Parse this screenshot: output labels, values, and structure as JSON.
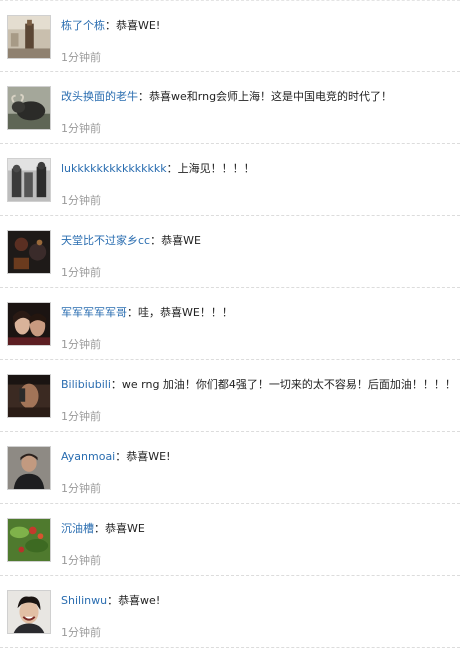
{
  "comments": [
    {
      "user": "栋了个栋",
      "sep": "：",
      "text": "恭喜WE!",
      "time": "1分钟前",
      "avatar": "avatar-street-photo"
    },
    {
      "user": "改头换面的老牛",
      "sep": "：",
      "text": "恭喜we和rng会师上海！这是中国电竞的时代了！",
      "time": "1分钟前",
      "avatar": "avatar-ox-photo"
    },
    {
      "user": "lukkkkkkkkkkkkkkk",
      "sep": "：",
      "text": "上海见！！！！",
      "time": "1分钟前",
      "avatar": "avatar-bw-photo"
    },
    {
      "user": "天堂比不过家乡cc",
      "sep": "：",
      "text": "恭喜WE",
      "time": "1分钟前",
      "avatar": "avatar-dark-photo"
    },
    {
      "user": "军军军军军哥",
      "sep": "：",
      "text": "哇，恭喜WE！！！",
      "time": "1分钟前",
      "avatar": "avatar-couple-photo"
    },
    {
      "user": "Bilibiubili",
      "sep": "：",
      "text": "we rng 加油！你们都4强了！一切来的太不容易！后面加油！！！！",
      "time": "1分钟前",
      "avatar": "avatar-phone-photo"
    },
    {
      "user": "Ayanmoai",
      "sep": "：",
      "text": "恭喜WE!",
      "time": "1分钟前",
      "avatar": "avatar-man-photo"
    },
    {
      "user": "沉油槽",
      "sep": "：",
      "text": "恭喜WE",
      "time": "1分钟前",
      "avatar": "avatar-plant-photo"
    },
    {
      "user": "Shilinwu",
      "sep": "：",
      "text": "恭喜we!",
      "time": "1分钟前",
      "avatar": "avatar-smile-photo"
    }
  ]
}
